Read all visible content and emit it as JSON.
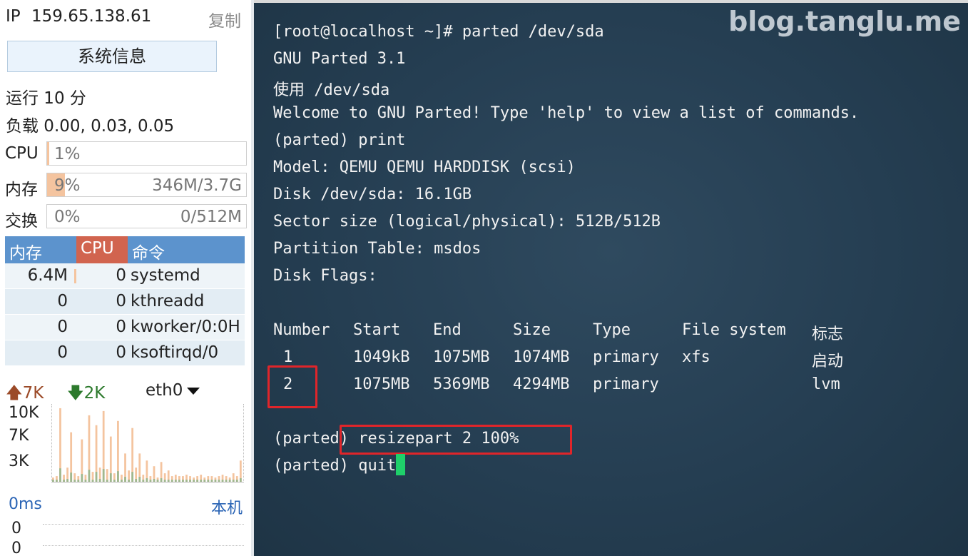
{
  "sidebar": {
    "ip_label": "IP",
    "ip_value": "159.65.138.61",
    "copy_label": "复制",
    "sysinfo_button": "系统信息",
    "uptime": "运行 10 分",
    "load": "负载 0.00, 0.03, 0.05",
    "cpu": {
      "label": "CPU",
      "percent_text": "1%",
      "fill": 0.01
    },
    "memory": {
      "label": "内存",
      "percent_text": "9%",
      "detail": "346M/3.7G",
      "fill": 0.09
    },
    "swap": {
      "label": "交换",
      "percent_text": "0%",
      "detail": "0/512M",
      "fill": 0.0
    },
    "process_table": {
      "headers": {
        "mem": "内存",
        "cpu": "CPU",
        "cmd": "命令"
      },
      "rows": [
        {
          "mem": "6.4M",
          "cpu": "0",
          "cmd": "systemd"
        },
        {
          "mem": "0",
          "cpu": "0",
          "cmd": "kthreadd"
        },
        {
          "mem": "0",
          "cpu": "0",
          "cmd": "kworker/0:0H"
        },
        {
          "mem": "0",
          "cpu": "0",
          "cmd": "ksoftirqd/0"
        }
      ]
    },
    "network": {
      "up": "7K",
      "down": "2K",
      "interface": "eth0",
      "y_labels": [
        "10K",
        "7K",
        "3K"
      ],
      "up_color": "#f4c49f",
      "down_color": "#9fb88f"
    },
    "ping": {
      "latency": "0ms",
      "target": "本机",
      "values": [
        "0",
        "0"
      ]
    }
  },
  "terminal": {
    "watermark": "blog.tanglu.me",
    "lines": [
      "[root@localhost ~]# parted /dev/sda",
      "GNU Parted 3.1",
      "使用 /dev/sda",
      "Welcome to GNU Parted! Type 'help' to view a list of commands.",
      "(parted) print",
      "Model: QEMU QEMU HARDDISK (scsi)",
      "Disk /dev/sda: 16.1GB",
      "Sector size (logical/physical): 512B/512B",
      "Partition Table: msdos",
      "Disk Flags:"
    ],
    "partition_table": {
      "headers": [
        "Number",
        "Start",
        "End",
        "Size",
        "Type",
        "File system",
        "标志"
      ],
      "rows": [
        [
          "1",
          "1049kB",
          "1075MB",
          "1074MB",
          "primary",
          "xfs",
          "启动"
        ],
        [
          "2",
          "1075MB",
          "5369MB",
          "4294MB",
          "primary",
          "",
          "lvm"
        ]
      ]
    },
    "resize_prompt": "(parted)",
    "resize_command": "resizepart 2 100%",
    "quit_line": "(parted) quit",
    "highlight_color": "#e0252a",
    "cursor_color": "#1fd06a"
  }
}
